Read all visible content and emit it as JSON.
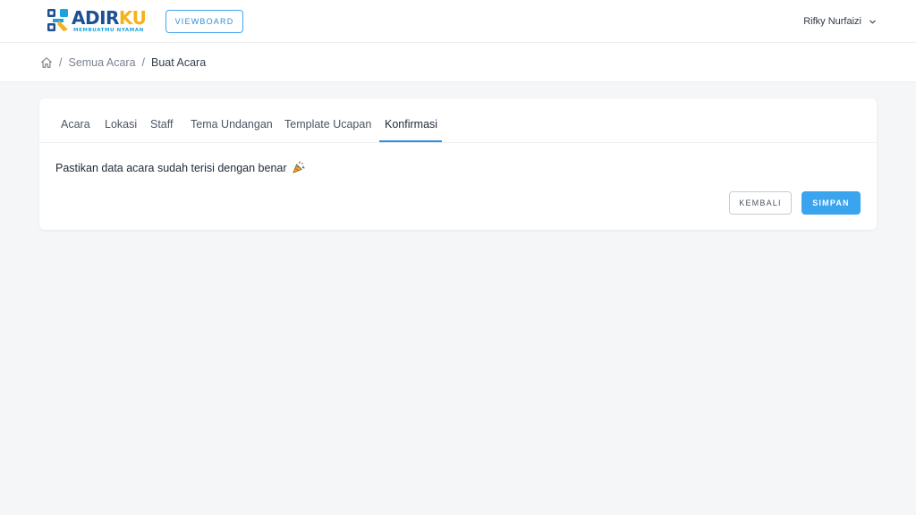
{
  "header": {
    "logo": {
      "word_part1": "ADIR",
      "word_part2": "KU",
      "tagline": "MEMBUATMU NYAMAN",
      "colors": {
        "primary": "#1d4f91",
        "accent": "#f6b21b",
        "tagline": "#1ba3e0"
      }
    },
    "viewboard_label": "VIEWBOARD",
    "user": {
      "name": "Rifky Nurfaizi",
      "dropdown_icon": "chevron-down-icon"
    }
  },
  "breadcrumb": {
    "home_icon": "home-icon",
    "separator": "/",
    "items": [
      "Semua Acara",
      "Buat Acara"
    ]
  },
  "tabs": [
    {
      "label": "Acara",
      "active": false
    },
    {
      "label": "Lokasi",
      "active": false
    },
    {
      "label": "Staff",
      "active": false
    },
    {
      "label": "Tema Undangan",
      "active": false
    },
    {
      "label": "Template Ucapan",
      "active": false
    },
    {
      "label": "Konfirmasi",
      "active": true
    }
  ],
  "confirm": {
    "message": "Pastikan data acara sudah terisi dengan benar",
    "emoji_icon": "party-popper-icon"
  },
  "actions": {
    "back_label": "KEMBALI",
    "save_label": "SIMPAN"
  },
  "colors": {
    "accent": "#3aa4ef",
    "background": "#f5f6f8"
  }
}
